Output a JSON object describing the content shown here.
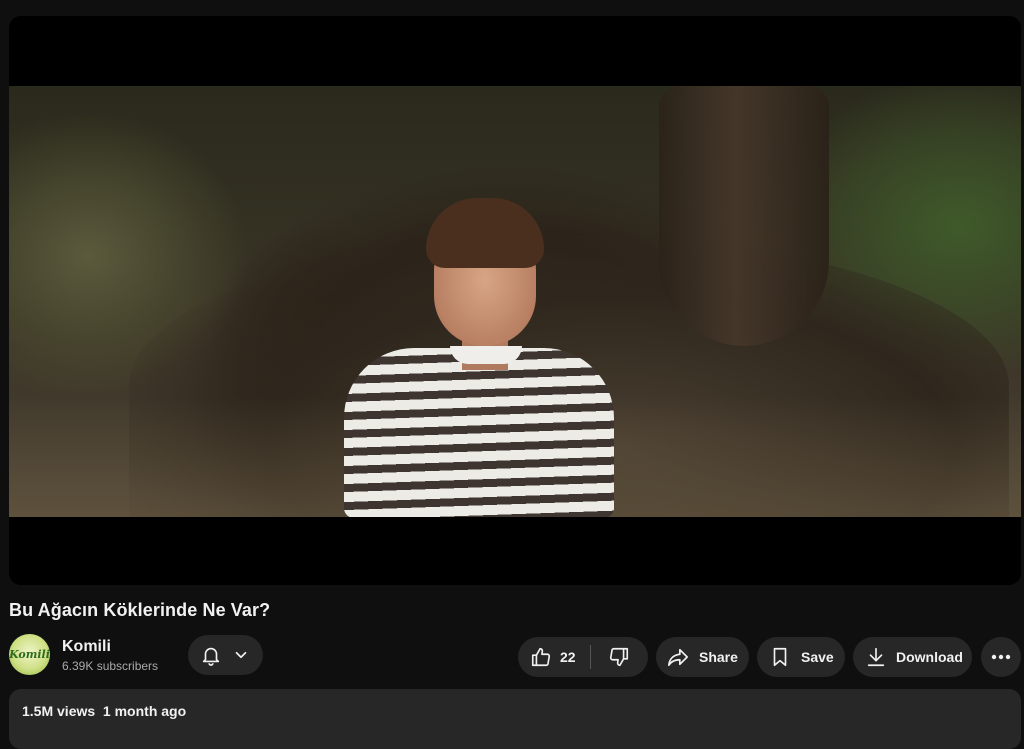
{
  "video": {
    "title": "Bu Ağacın Köklerinde Ne Var?"
  },
  "channel": {
    "name": "Komili",
    "subscribers": "6.39K subscribers",
    "avatar_text": "Komili"
  },
  "actions": {
    "like_count": "22",
    "share_label": "Share",
    "save_label": "Save",
    "download_label": "Download"
  },
  "description": {
    "meta": "1.5M views  1 month ago"
  },
  "icons": {
    "bell": "bell-icon",
    "chevron": "chevron-down-icon",
    "like": "thumbs-up-icon",
    "dislike": "thumbs-down-icon",
    "share": "share-arrow-icon",
    "save": "bookmark-icon",
    "download": "download-icon",
    "more": "more-horizontal-icon"
  },
  "colors": {
    "background": "#0f0f0f",
    "pill": "#272727",
    "text": "#f1f1f1",
    "secondary_text": "#aaaaaa"
  }
}
